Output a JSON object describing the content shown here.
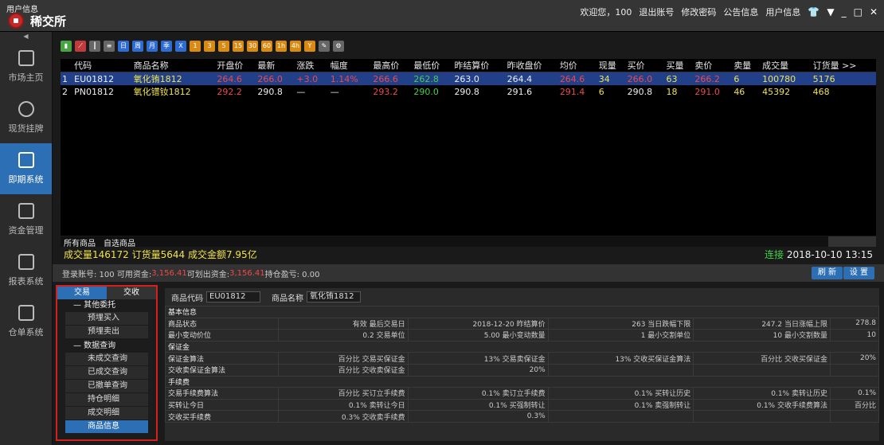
{
  "header": {
    "user_info": "用户信息",
    "logo": "稀交所",
    "welcome": "欢迎您，100",
    "logout": "退出账号",
    "change_pwd": "修改密码",
    "announce": "公告信息",
    "user_menu": "用户信息",
    "min": "_",
    "max": "□",
    "close": "✕"
  },
  "nav": [
    {
      "label": "市场主页",
      "icon": "home-icon"
    },
    {
      "label": "现货挂牌",
      "icon": "yen-icon"
    },
    {
      "label": "即期系统",
      "icon": "clipboard-yen-icon"
    },
    {
      "label": "资金管理",
      "icon": "calendar-icon"
    },
    {
      "label": "报表系统",
      "icon": "report-icon"
    },
    {
      "label": "仓单系统",
      "icon": "warehouse-icon"
    }
  ],
  "toolbar": [
    "1",
    "3",
    "5",
    "15",
    "30",
    "60",
    "1h",
    "4h",
    "Y"
  ],
  "quotes": {
    "headers": [
      "",
      "代码",
      "商品名称",
      "开盘价",
      "最新",
      "涨跌",
      "幅度",
      "最高价",
      "最低价",
      "昨结算价",
      "昨收盘价",
      "均价",
      "现量",
      "买价",
      "买量",
      "卖价",
      "卖量",
      "成交量",
      "订货量 >>"
    ],
    "rows": [
      [
        "1",
        "EU01812",
        "氧化铕1812",
        "264.6",
        "266.0",
        "+3.0",
        "1.14%",
        "266.6",
        "262.8",
        "263.0",
        "264.4",
        "264.6",
        "34",
        "266.0",
        "63",
        "266.2",
        "6",
        "100780",
        "5176"
      ],
      [
        "2",
        "PN01812",
        "氧化镨钕1812",
        "292.2",
        "290.8",
        "—",
        "—",
        "293.2",
        "290.0",
        "290.8",
        "291.6",
        "291.4",
        "6",
        "290.8",
        "18",
        "291.0",
        "46",
        "45392",
        "468"
      ]
    ]
  },
  "bottom_tabs": {
    "all": "所有商品",
    "fav": "自选商品"
  },
  "status": {
    "summary": "成交量146172  订货量5644  成交金额7.95亿",
    "conn": "连接",
    "time": "2018-10-10 13:15"
  },
  "account": {
    "label": "登录账号: 100  可用资金: ",
    "avail": "3,156.41",
    "withdraw_label": "  可划出资金: ",
    "withdraw": "3,156.41",
    "pl": "  持仓盈亏: 0.00",
    "refresh": "刷 新",
    "settings": "设 置"
  },
  "sub": {
    "tab1": "交易",
    "tab2": "交收",
    "g1": "— 其他委托",
    "i1": "预埋买入",
    "i2": "预埋卖出",
    "g2": "— 数据查询",
    "q": [
      "未成交查询",
      "已成交查询",
      "已撤单查询",
      "持仓明细",
      "成交明细",
      "商品信息"
    ]
  },
  "detail": {
    "code_label": "商品代码",
    "code": "EU01812",
    "name_label": "商品名称",
    "name": "氧化铕1812"
  },
  "colors": {
    "accent": "#2d6fb4",
    "red": "#f04848",
    "yellow": "#f0e34a",
    "green": "#42d24a"
  }
}
